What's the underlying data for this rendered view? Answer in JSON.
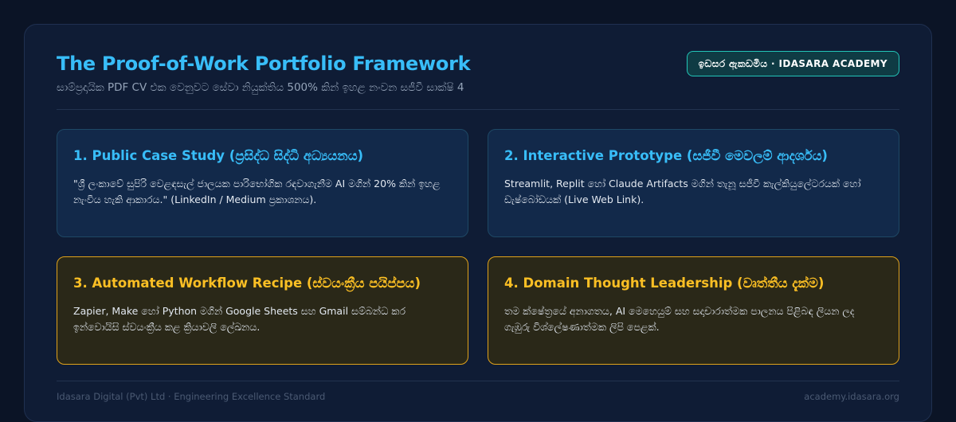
{
  "header": {
    "title": "The Proof-of-Work Portfolio Framework",
    "subtitle": "සාම්ප්‍රදායික PDF CV එක වෙනුවට සේවා නියුක්තිය 500% කින් ඉහළ නංවන සජීවී සාක්ෂි 4",
    "badge": "ඉඩසර ඇකඩමිය · IDASARA ACADEMY"
  },
  "cards": [
    {
      "title": "1. Public Case Study (ප්‍රසිද්ධ සිද්ධි අධ්‍යයනය)",
      "body": "\"ශ්‍රී ලංකාවේ සුපිරි වෙළඳසැල් ජාලයක පාරිභෝගික රඳවාගැනීම AI මගින් 20% කින් ඉහළ නැංවිය හැකි ආකාරය.\" (LinkedIn / Medium ප්‍රකාශනය)."
    },
    {
      "title": "2. Interactive Prototype (සජීවී මෙවලම් ආදර්ශය)",
      "body": "Streamlit, Replit හෝ Claude Artifacts මගින් තැනූ සජීවී කැල්කියුලේටරයක් හෝ ඩැෂ්බෝඩයක් (Live Web Link)."
    },
    {
      "title": "3. Automated Workflow Recipe (ස්වයංක්‍රීය පයිප්පය)",
      "body": "Zapier, Make හෝ Python මගින් Google Sheets සහ Gmail සම්බන්ධ කර ඉන්වොයිසි ස්වයංක්‍රීය කළ ක්‍රියාවලි ලේඛනය."
    },
    {
      "title": "4. Domain Thought Leadership (වෘත්තීය දැක්ම)",
      "body": "තම ක්ෂේත්‍රයේ අනාගතය, AI මෙහෙයුම් සහ සදාචාරාත්මක පාලනය පිළිබඳ ලියන ලද ගැඹුරු විශ්ලේෂණාත්මක ලිපි පෙළක්."
    }
  ],
  "footer": {
    "left": "Idasara Digital (Pvt) Ltd · Engineering Excellence Standard",
    "right": "academy.idasara.org"
  },
  "colors": {
    "accent_blue": "#38bdf8",
    "accent_amber": "#fbbf24",
    "badge_border": "#22c5b8"
  }
}
